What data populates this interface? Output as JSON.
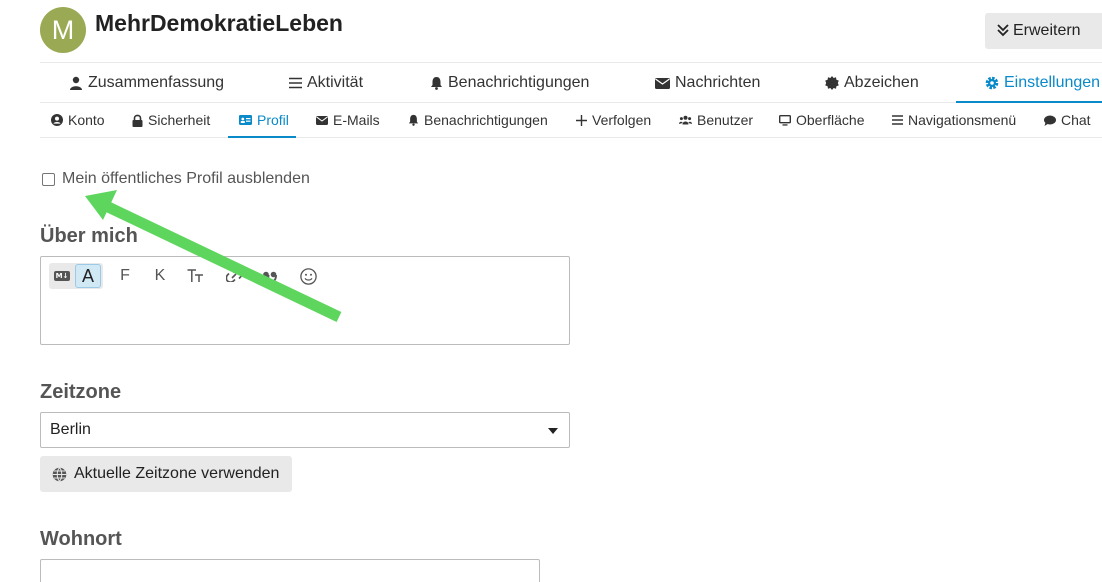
{
  "header": {
    "avatar_letter": "M",
    "username": "MehrDemokratieLeben",
    "expand_label": "Erweitern"
  },
  "main_nav": {
    "items": [
      {
        "label": "Zusammenfassung",
        "icon": "user-icon"
      },
      {
        "label": "Aktivität",
        "icon": "list-icon"
      },
      {
        "label": "Benachrichtigungen",
        "icon": "bell-icon"
      },
      {
        "label": "Nachrichten",
        "icon": "envelope-icon"
      },
      {
        "label": "Abzeichen",
        "icon": "badge-icon"
      },
      {
        "label": "Einstellungen",
        "icon": "gear-icon",
        "active": true
      }
    ]
  },
  "sub_nav": {
    "items": [
      {
        "label": "Konto",
        "icon": "user-circle-icon"
      },
      {
        "label": "Sicherheit",
        "icon": "lock-icon"
      },
      {
        "label": "Profil",
        "icon": "id-card-icon",
        "active": true
      },
      {
        "label": "E-Mails",
        "icon": "envelope-icon"
      },
      {
        "label": "Benachrichtigungen",
        "icon": "bell-icon"
      },
      {
        "label": "Verfolgen",
        "icon": "plus-icon"
      },
      {
        "label": "Benutzer",
        "icon": "users-icon"
      },
      {
        "label": "Oberfläche",
        "icon": "desktop-icon"
      },
      {
        "label": "Navigationsmenü",
        "icon": "bars-icon"
      },
      {
        "label": "Chat",
        "icon": "comment-icon"
      }
    ]
  },
  "profile": {
    "hide_profile_label": "Mein öffentliches Profil ausblenden",
    "hide_profile_checked": false,
    "about_label": "Über mich",
    "editor_toolbar": {
      "rich_label": "A",
      "bold_label": "F",
      "italic_label": "K"
    },
    "timezone_label": "Zeitzone",
    "timezone_value": "Berlin",
    "use_current_timezone_label": "Aktuelle Zeitzone verwenden",
    "location_label": "Wohnort",
    "location_value": ""
  },
  "colors": {
    "accent": "#0a8ac8",
    "avatar": "#9aaa54",
    "arrow": "#5ed65e"
  }
}
